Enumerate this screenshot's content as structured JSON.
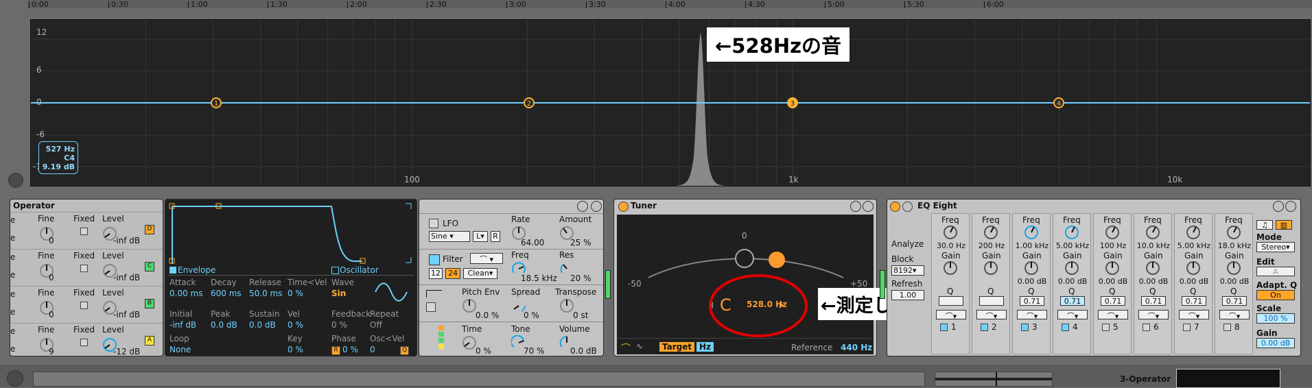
{
  "timeline": {
    "ticks": [
      "0:00",
      "0:30",
      "1:00",
      "1:30",
      "2:00",
      "2:30",
      "3:00",
      "3:30",
      "4:00",
      "4:30",
      "5:00",
      "5:30",
      "6:00"
    ]
  },
  "spectrum": {
    "y_labels": [
      "12",
      "6",
      "0",
      "-6",
      "-12"
    ],
    "x_labels": [
      "100",
      "1k",
      "10k"
    ],
    "eq_points": [
      "1",
      "2",
      "3",
      "4"
    ],
    "badge": {
      "freq": "527 Hz",
      "note": "C4",
      "level": "9.19 dB"
    },
    "callout": "←528Hzの音",
    "line_color": "#6ed1ff",
    "point_color": "#ffb233"
  },
  "operator": {
    "title": "Operator",
    "rows": [
      {
        "fine": "Fine",
        "fine_val": "0",
        "fixed": "Fixed",
        "level": "Level",
        "level_val": "-inf dB",
        "osc": "D",
        "osc_color": "#ffa52a"
      },
      {
        "fine": "Fine",
        "fine_val": "0",
        "fixed": "Fixed",
        "level": "Level",
        "level_val": "-inf dB",
        "osc": "C",
        "osc_color": "#4fd86a"
      },
      {
        "fine": "Fine",
        "fine_val": "0",
        "fixed": "Fixed",
        "level": "Level",
        "level_val": "-inf dB",
        "osc": "B",
        "osc_color": "#4fd86a"
      },
      {
        "fine": "Fine",
        "fine_val": "9",
        "fixed": "Fixed",
        "level": "Level",
        "level_val": "-12 dB",
        "osc": "A",
        "osc_color": "#ffe23a"
      }
    ],
    "envelope": {
      "envelope_label": "Envelope",
      "oscillator_label": "Oscillator",
      "attack": "Attack",
      "attack_val": "0.00 ms",
      "decay": "Decay",
      "decay_val": "600 ms",
      "release": "Release",
      "release_val": "50.0 ms",
      "timevel": "Time<Vel",
      "timevel_val": "0 %",
      "wave": "Wave",
      "wave_val": "Sin",
      "initial": "Initial",
      "initial_val": "-inf dB",
      "peak": "Peak",
      "peak_val": "0.0 dB",
      "sustain": "Sustain",
      "sustain_val": "0.0 dB",
      "vel": "Vel",
      "vel_val": "0 %",
      "feedback": "Feedback",
      "feedback_val": "0 %",
      "repeat": "Repeat",
      "repeat_val": "Off",
      "loop": "Loop",
      "loop_val": "None",
      "key": "Key",
      "key_val": "0 %",
      "phase": "Phase",
      "phase_r": "R",
      "phase_val": "0 %",
      "oscvel": "Osc<Vel",
      "oscvel_val": "0",
      "oscvel_q": "Q"
    },
    "lfo": {
      "lfo": "LFO",
      "shape": "Sine",
      "l": "L",
      "r": "R",
      "rate": "Rate",
      "rate_val": "64.00",
      "amount": "Amount",
      "amount_val": "25 %",
      "filter": "Filter",
      "freq": "Freq",
      "freq_val": "18.5 kHz",
      "res": "Res",
      "res_val": "20 %",
      "slope12": "12",
      "slope24": "24",
      "clean": "Clean",
      "pitchenv": "Pitch Env",
      "pitchenv_val": "0.0 %",
      "spread": "Spread",
      "spread_val": "0 %",
      "transpose": "Transpose",
      "transpose_val": "0 st",
      "time": "Time",
      "time_val": "0 %",
      "tone": "Tone",
      "tone_val": "70 %",
      "volume": "Volume",
      "volume_val": "0.0 dB"
    }
  },
  "tuner": {
    "title": "Tuner",
    "center_label": "0",
    "left_label": "-50",
    "right_label": "+50",
    "note": "C",
    "freq": "528.0 Hz",
    "target": "Target",
    "hz": "Hz",
    "reference": "Reference",
    "reference_val": "440 Hz",
    "callout": "←測定した表示",
    "circle_color": "#e00000"
  },
  "eq": {
    "title": "EQ Eight",
    "analyze": "Analyze",
    "block": "Block",
    "block_val": "8192",
    "refresh": "Refresh",
    "refresh_val": "1.00",
    "bands": [
      {
        "freq": "30.0 Hz",
        "gain": "",
        "q": "",
        "num": "1"
      },
      {
        "freq": "200 Hz",
        "gain": "",
        "q": "",
        "num": "2"
      },
      {
        "freq": "1.00 kHz",
        "gain": "0.00 dB",
        "q": "0.71",
        "num": "3"
      },
      {
        "freq": "5.00 kHz",
        "gain": "0.00 dB",
        "q": "0.71",
        "num": "4"
      },
      {
        "freq": "100 Hz",
        "gain": "0.00 dB",
        "q": "0.71",
        "num": "5"
      },
      {
        "freq": "10.0 kHz",
        "gain": "0.00 dB",
        "q": "0.71",
        "num": "6"
      },
      {
        "freq": "5.00 kHz",
        "gain": "0.00 dB",
        "q": "0.71",
        "num": "7"
      },
      {
        "freq": "18.0 kHz",
        "gain": "0.00 dB",
        "q": "0.71",
        "num": "8"
      }
    ],
    "freq_label": "Freq",
    "gain_label": "Gain",
    "q_label": "Q",
    "mode": "Mode",
    "mode_val": "Stereo",
    "edit": "Edit",
    "edit_val": "A",
    "adapt": "Adapt. Q",
    "adapt_val": "On",
    "scale": "Scale",
    "scale_val": "100 %",
    "gain": "Gain",
    "gain_val": "0.00 dB"
  },
  "bottom": {
    "track_name": "3-Operator"
  }
}
